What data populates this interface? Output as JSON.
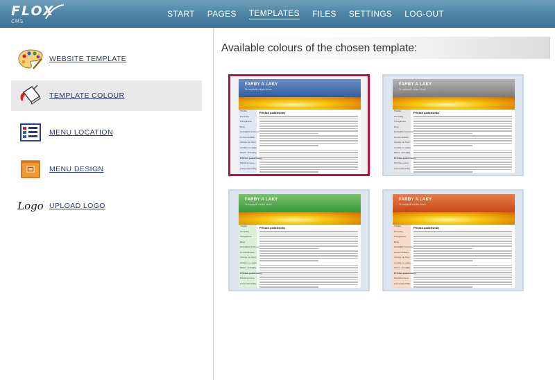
{
  "header": {
    "logo_main": "FLO",
    "logo_x": "X",
    "logo_sub": "CMS",
    "nav": [
      {
        "label": "START",
        "active": false
      },
      {
        "label": "PAGES",
        "active": false
      },
      {
        "label": "TEMPLATES",
        "active": true
      },
      {
        "label": "FILES",
        "active": false
      },
      {
        "label": "SETTINGS",
        "active": false
      },
      {
        "label": "LOG-OUT",
        "active": false
      }
    ]
  },
  "sidebar": {
    "items": [
      {
        "label": "WEBSITE TEMPLATE",
        "icon": "palette-icon"
      },
      {
        "label": "TEMPLATE COLOUR",
        "icon": "paint-bucket-icon",
        "active": true
      },
      {
        "label": "MENU LOCATION",
        "icon": "menu-layout-icon"
      },
      {
        "label": "MENU DESIGN",
        "icon": "menu-design-icon"
      },
      {
        "label": "UPLOAD LOGO",
        "icon": "logo-text-icon",
        "icon_text": "Logo"
      }
    ]
  },
  "main": {
    "title": "Available colours of the chosen template:",
    "thumbnails": [
      {
        "color": "blue",
        "selected": true
      },
      {
        "color": "gray",
        "selected": false
      },
      {
        "color": "green",
        "selected": false
      },
      {
        "color": "orange",
        "selected": false
      }
    ]
  },
  "mini_template": {
    "title": "FARBY A LAKY",
    "subtitle": "To nejlepší nejen dnes",
    "heading": "Přiklad podstránky",
    "menu": [
      "Titulka",
      "Produkty",
      "Fotogalerie",
      "Blog",
      "Kontaktní formulář",
      "Kniha návštěv",
      "Články ke čtení",
      "Anketa na webu",
      "Název aktuality",
      "Příklad podstránky",
      "Položka menu",
      "Jiné podpoložky",
      "Nová položka",
      "Ostatní",
      "Dalsi-prvek"
    ]
  },
  "colors": {
    "selected_border": "#b3153d",
    "header_bg": "#4f84a6",
    "link": "#2a3a6a"
  }
}
